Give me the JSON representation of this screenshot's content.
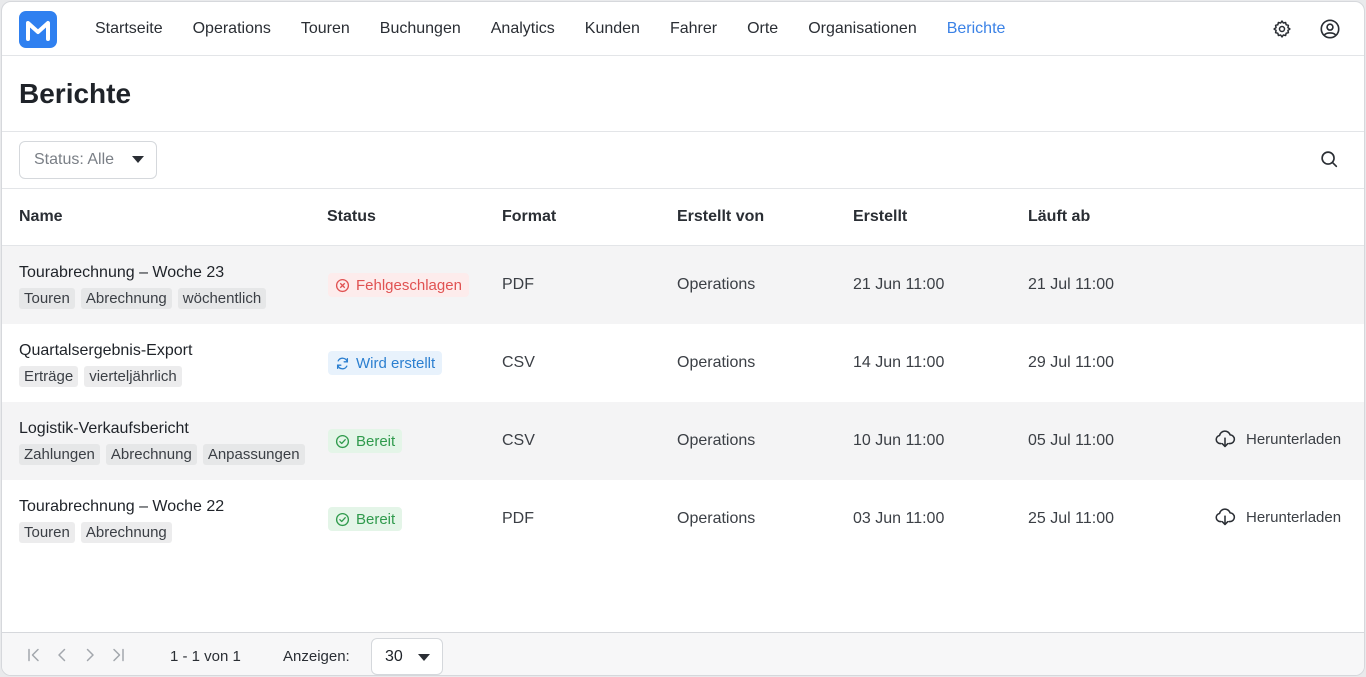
{
  "nav": {
    "logo_icon": "brand-m-logo",
    "items": [
      {
        "label": "Startseite",
        "active": false
      },
      {
        "label": "Operations",
        "active": false
      },
      {
        "label": "Touren",
        "active": false
      },
      {
        "label": "Buchungen",
        "active": false
      },
      {
        "label": "Analytics",
        "active": false
      },
      {
        "label": "Kunden",
        "active": false
      },
      {
        "label": "Fahrer",
        "active": false
      },
      {
        "label": "Orte",
        "active": false
      },
      {
        "label": "Organisationen",
        "active": false
      },
      {
        "label": "Berichte",
        "active": true
      }
    ],
    "icons": [
      "gear-icon",
      "user-circle-icon"
    ]
  },
  "page": {
    "title": "Berichte"
  },
  "filter": {
    "status_label": "Status: Alle",
    "search_icon": "search-icon"
  },
  "table": {
    "columns": [
      "Name",
      "Status",
      "Format",
      "Erstellt von",
      "Erstellt",
      "Läuft ab"
    ],
    "rows": [
      {
        "name": "Tourabrechnung – Woche 23",
        "tags": [
          "Touren",
          "Abrechnung",
          "wöchentlich"
        ],
        "status": "Fehlgeschlagen",
        "status_type": "failed",
        "format": "PDF",
        "created_by": "Operations",
        "created": "21 Jun 11:00",
        "expires": "21 Jul 11:00",
        "download": ""
      },
      {
        "name": "Quartalsergebnis-Export",
        "tags": [
          "Erträge",
          "vierteljährlich"
        ],
        "status": "Wird erstellt",
        "status_type": "building",
        "format": "CSV",
        "created_by": "Operations",
        "created": "14 Jun 11:00",
        "expires": "29 Jul 11:00",
        "download": ""
      },
      {
        "name": "Logistik-Verkaufsbericht",
        "tags": [
          "Zahlungen",
          "Abrechnung",
          "Anpassungen"
        ],
        "status": "Bereit",
        "status_type": "ready",
        "format": "CSV",
        "created_by": "Operations",
        "created": "10 Jun 11:00",
        "expires": "05 Jul 11:00",
        "download": "Herunterladen"
      },
      {
        "name": "Tourabrechnung – Woche 22",
        "tags": [
          "Touren",
          "Abrechnung"
        ],
        "status": "Bereit",
        "status_type": "ready",
        "format": "PDF",
        "created_by": "Operations",
        "created": "03 Jun 11:00",
        "expires": "25 Jul 11:00",
        "download": "Herunterladen"
      }
    ]
  },
  "footer": {
    "range": "1 - 1 von 1",
    "show_label": "Anzeigen:",
    "per_page": "30"
  },
  "colors": {
    "accent": "#3b82e6",
    "failed": "#e05252",
    "building": "#2b7fd0",
    "ready": "#2f9a4c"
  }
}
